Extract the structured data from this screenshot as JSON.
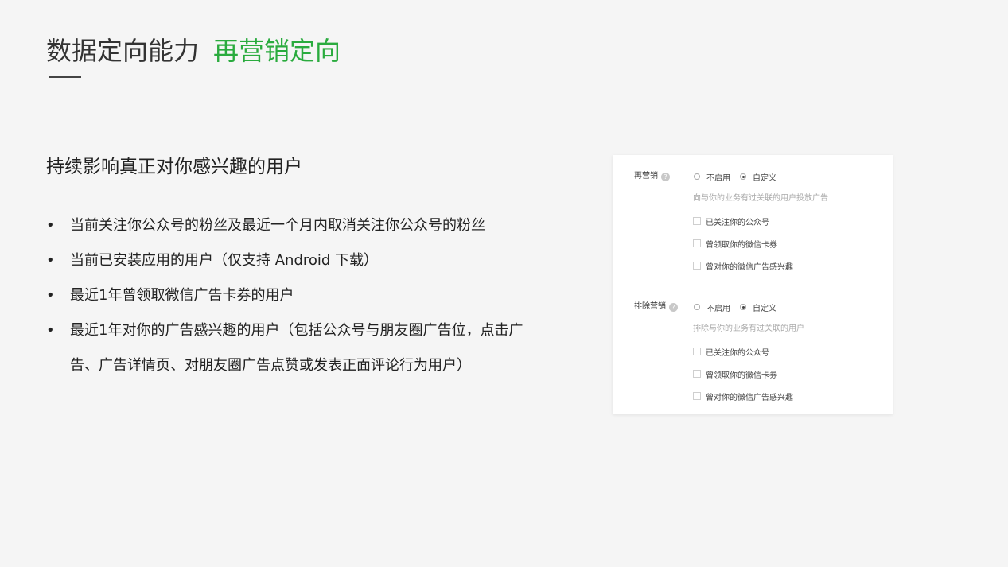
{
  "slide": {
    "title_main": "数据定向能力",
    "title_accent": "再营销定向",
    "subtitle": "持续影响真正对你感兴趣的用户",
    "bullets": [
      "当前关注你公众号的粉丝及最近一个月内取消关注你公众号的粉丝",
      "当前已安装应用的用户（仅支持 Android 下载）",
      "最近1年曾领取微信广告卡券的用户",
      "最近1年对你的广告感兴趣的用户（包括公众号与朋友圈广告位，点击广告、广告详情页、对朋友圈广告点赞或发表正面评论行为用户）"
    ],
    "bullet_symbol": "•",
    "accent_color": "#2aab3e"
  },
  "card": {
    "retarget": {
      "label": "再营销",
      "help": "?",
      "radio_off": "不启用",
      "radio_custom": "自定义",
      "selected": "自定义",
      "hint": "向与你的业务有过关联的用户投放广告",
      "options": [
        "已关注你的公众号",
        "曾领取你的微信卡券",
        "曾对你的微信广告感兴趣"
      ]
    },
    "exclude": {
      "label": "排除营销",
      "help": "?",
      "radio_off": "不启用",
      "radio_custom": "自定义",
      "selected": "自定义",
      "hint": "排除与你的业务有过关联的用户",
      "options": [
        "已关注你的公众号",
        "曾领取你的微信卡券",
        "曾对你的微信广告感兴趣"
      ]
    }
  }
}
